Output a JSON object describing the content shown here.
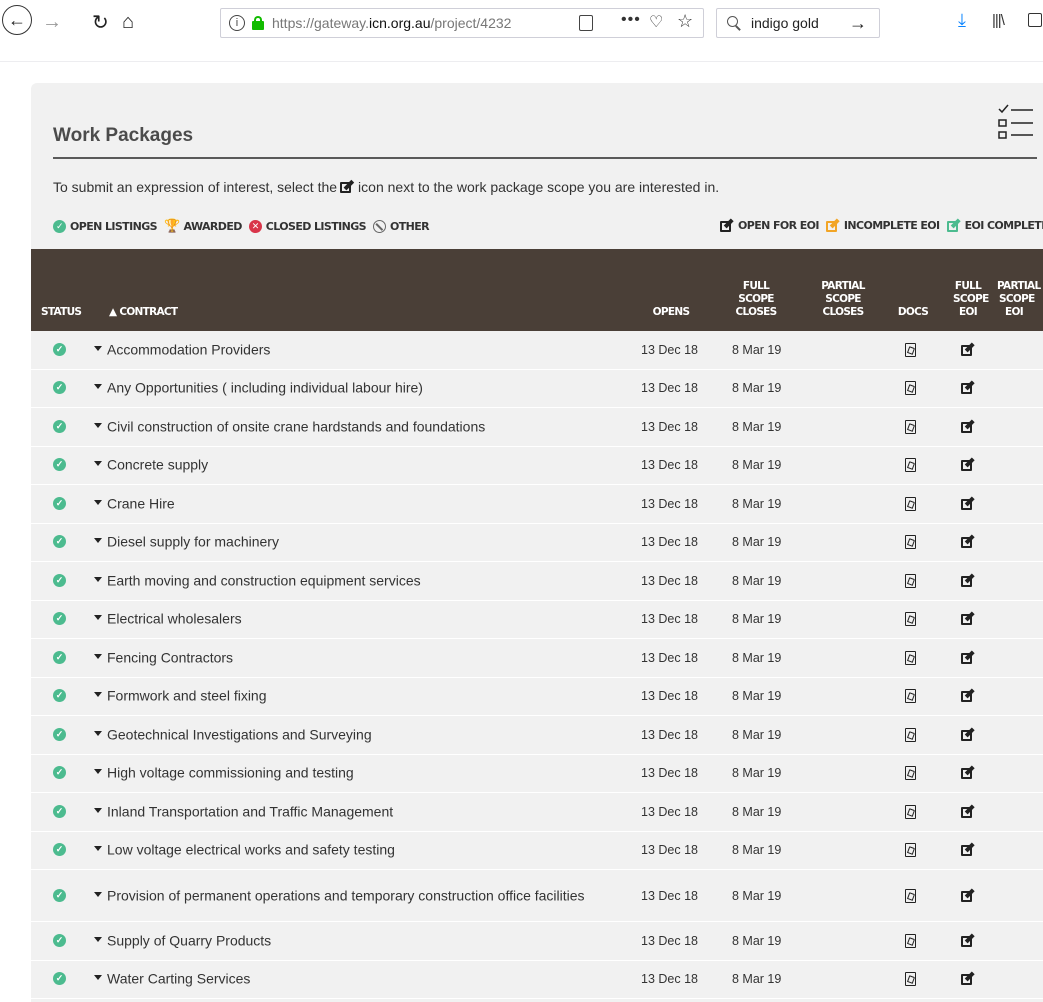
{
  "browser": {
    "url_prefix": "https://gateway.",
    "url_domain": "icn.org.au",
    "url_suffix": "/project/4232",
    "search_query": "indigo gold",
    "more_glyph": "•••"
  },
  "page": {
    "title": "Work Packages",
    "intro_before": "To submit an expression of interest, select the",
    "intro_after": "icon next to the work package scope you are interested in."
  },
  "legend": {
    "left": [
      {
        "label": "OPEN LISTINGS",
        "icon": "check-circle-icon",
        "color": "#4cbb8f"
      },
      {
        "label": "AWARDED",
        "icon": "trophy-icon",
        "color": "#f2a526"
      },
      {
        "label": "CLOSED LISTINGS",
        "icon": "x-circle-icon",
        "color": "#d9354a"
      },
      {
        "label": "OTHER",
        "icon": "ban-icon",
        "color": "#666666"
      }
    ],
    "right": [
      {
        "label": "OPEN FOR EOI",
        "icon": "edit-icon",
        "color": "#222222"
      },
      {
        "label": "INCOMPLETE EOI",
        "icon": "edit-icon",
        "color": "#f2a526"
      },
      {
        "label": "EOI COMPLETED",
        "icon": "edit-icon",
        "color": "#4cbb8f"
      }
    ]
  },
  "table": {
    "header_bg": "#4a3f37",
    "columns": {
      "status": "STATUS",
      "contract": "▲ CONTRACT",
      "opens": "OPENS",
      "full_closes_1": "FULL",
      "full_closes_2": "SCOPE",
      "full_closes_3": "CLOSES",
      "partial_closes_1": "PARTIAL",
      "partial_closes_2": "SCOPE",
      "partial_closes_3": "CLOSES",
      "docs": "DOCS",
      "full_eoi_1": "FULL",
      "full_eoi_2": "SCOPE",
      "full_eoi_3": "EOI",
      "partial_eoi_1": "PARTIAL",
      "partial_eoi_2": "SCOPE",
      "partial_eoi_3": "EOI"
    },
    "rows": [
      {
        "name": "Accommodation Providers",
        "opens": "13 Dec 18",
        "closes": "8 Mar 19"
      },
      {
        "name": "Any Opportunities ( including individual labour hire)",
        "opens": "13 Dec 18",
        "closes": "8 Mar 19"
      },
      {
        "name": "Civil construction of onsite crane hardstands and foundations",
        "opens": "13 Dec 18",
        "closes": "8 Mar 19"
      },
      {
        "name": "Concrete supply",
        "opens": "13 Dec 18",
        "closes": "8 Mar 19"
      },
      {
        "name": "Crane Hire",
        "opens": "13 Dec 18",
        "closes": "8 Mar 19"
      },
      {
        "name": "Diesel supply for machinery",
        "opens": "13 Dec 18",
        "closes": "8 Mar 19"
      },
      {
        "name": "Earth moving and construction equipment services",
        "opens": "13 Dec 18",
        "closes": "8 Mar 19"
      },
      {
        "name": "Electrical wholesalers",
        "opens": "13 Dec 18",
        "closes": "8 Mar 19"
      },
      {
        "name": "Fencing Contractors",
        "opens": "13 Dec 18",
        "closes": "8 Mar 19"
      },
      {
        "name": "Formwork and steel fixing",
        "opens": "13 Dec 18",
        "closes": "8 Mar 19"
      },
      {
        "name": "Geotechnical Investigations and Surveying",
        "opens": "13 Dec 18",
        "closes": "8 Mar 19"
      },
      {
        "name": "High voltage commissioning and testing",
        "opens": "13 Dec 18",
        "closes": "8 Mar 19"
      },
      {
        "name": "Inland Transportation and Traffic Management",
        "opens": "13 Dec 18",
        "closes": "8 Mar 19"
      },
      {
        "name": "Low voltage electrical works and safety testing",
        "opens": "13 Dec 18",
        "closes": "8 Mar 19"
      },
      {
        "name": "Provision of permanent operations and temporary construction office facilities",
        "opens": "13 Dec 18",
        "closes": "8 Mar 19"
      },
      {
        "name": "Supply of Quarry Products",
        "opens": "13 Dec 18",
        "closes": "8 Mar 19"
      },
      {
        "name": "Water Carting Services",
        "opens": "13 Dec 18",
        "closes": "8 Mar 19"
      }
    ]
  }
}
